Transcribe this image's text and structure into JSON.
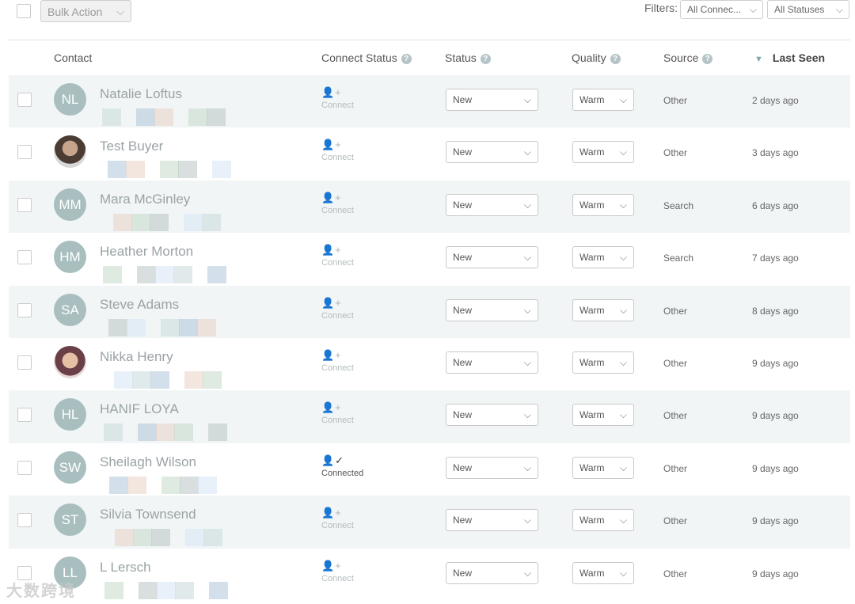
{
  "toolbar": {
    "bulk_action_label": "Bulk Action",
    "filters_label": "Filters:",
    "filter_connect_value": "All Connec...",
    "filter_status_value": "All Statuses"
  },
  "columns": {
    "contact": "Contact",
    "connect_status": "Connect Status",
    "status": "Status",
    "quality": "Quality",
    "source": "Source",
    "last_seen": "Last Seen"
  },
  "rows": [
    {
      "initials": "NL",
      "name": "Natalie Loftus",
      "avatar": "initials",
      "connect": "Connect",
      "connected": false,
      "status": "New",
      "quality": "Warm",
      "source": "Other",
      "last_seen": "2 days ago"
    },
    {
      "initials": "",
      "name": "Test Buyer",
      "avatar": "photo1",
      "connect": "Connect",
      "connected": false,
      "status": "New",
      "quality": "Warm",
      "source": "Other",
      "last_seen": "3 days ago"
    },
    {
      "initials": "MM",
      "name": "Mara McGinley",
      "avatar": "initials",
      "connect": "Connect",
      "connected": false,
      "status": "New",
      "quality": "Warm",
      "source": "Search",
      "last_seen": "6 days ago"
    },
    {
      "initials": "HM",
      "name": "Heather Morton",
      "avatar": "initials",
      "connect": "Connect",
      "connected": false,
      "status": "New",
      "quality": "Warm",
      "source": "Search",
      "last_seen": "7 days ago"
    },
    {
      "initials": "SA",
      "name": "Steve Adams",
      "avatar": "initials",
      "connect": "Connect",
      "connected": false,
      "status": "New",
      "quality": "Warm",
      "source": "Other",
      "last_seen": "8 days ago"
    },
    {
      "initials": "",
      "name": "Nikka Henry",
      "avatar": "photo2",
      "connect": "Connect",
      "connected": false,
      "status": "New",
      "quality": "Warm",
      "source": "Other",
      "last_seen": "9 days ago"
    },
    {
      "initials": "HL",
      "name": "HANIF LOYA",
      "avatar": "initials",
      "connect": "Connect",
      "connected": false,
      "status": "New",
      "quality": "Warm",
      "source": "Other",
      "last_seen": "9 days ago"
    },
    {
      "initials": "SW",
      "name": "Sheilagh Wilson",
      "avatar": "initials",
      "connect": "Connected",
      "connected": true,
      "status": "New",
      "quality": "Warm",
      "source": "Other",
      "last_seen": "9 days ago"
    },
    {
      "initials": "ST",
      "name": "Silvia Townsend",
      "avatar": "initials",
      "connect": "Connect",
      "connected": false,
      "status": "New",
      "quality": "Warm",
      "source": "Other",
      "last_seen": "9 days ago"
    },
    {
      "initials": "LL",
      "name": "L Lersch",
      "avatar": "initials",
      "connect": "Connect",
      "connected": false,
      "status": "New",
      "quality": "Warm",
      "source": "Other",
      "last_seen": "9 days ago"
    }
  ],
  "watermark": "大数跨境"
}
